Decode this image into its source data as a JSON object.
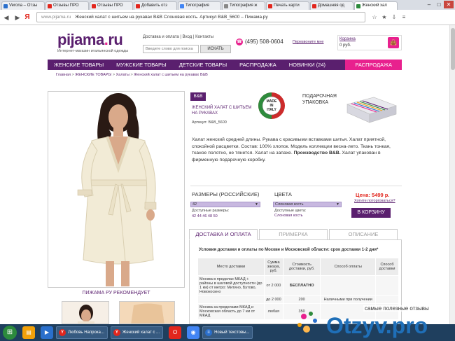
{
  "browser": {
    "tabs": [
      {
        "label": "Verona – Отзы",
        "color": "#2a6fcc",
        "active": false
      },
      {
        "label": "Отзывы ПРО",
        "color": "#e2261d",
        "active": false
      },
      {
        "label": "Отзывы ПРО",
        "color": "#e2261d",
        "active": false
      },
      {
        "label": "Добавить отз",
        "color": "#e2261d",
        "active": false
      },
      {
        "label": "Типография",
        "color": "#4285f4",
        "active": false
      },
      {
        "label": "Типография ж",
        "color": "#888888",
        "active": false
      },
      {
        "label": "Печать карти",
        "color": "#e2261d",
        "active": false
      },
      {
        "label": "Домашняя од",
        "color": "#e2261d",
        "active": false
      },
      {
        "label": "Женский хал",
        "color": "#2c8a3d",
        "active": true
      }
    ],
    "window_controls": {
      "minimize": "–",
      "maximize": "□",
      "close": "✕"
    },
    "yandex_letter": "Я",
    "url_host": "www.pijama.ru",
    "url_title": "Женский халат с шитьем на рукавах B&B Слоновая кость. Артикул B&B_5600 – Пижама.ру"
  },
  "site": {
    "logo_main": "pijama",
    "logo_dot": ".",
    "logo_tld": "ru",
    "tagline": "Интернет-магазин итальянской одежды",
    "top_links": [
      "Доставка и оплата",
      "Вход",
      "Контакты"
    ],
    "top_links_sep": " | ",
    "search_placeholder": "Введите слово для поиска",
    "search_button": "ИСКАТЬ",
    "phone": "(495) 508-0604",
    "callback": "Перезвоните мне",
    "cart_label": "Корзина",
    "cart_sum": "0 руб."
  },
  "nav": {
    "items": [
      "ЖЕНСКИЕ ТОВАРЫ",
      "МУЖСКИЕ ТОВАРЫ",
      "ДЕТСКИЕ ТОВАРЫ",
      "РАСПРОДАЖА",
      "НОВИНКИ (24)"
    ],
    "sale": "РАСПРОДАЖА"
  },
  "breadcrumb": {
    "items": [
      "Главная",
      "ЖЕНСКИЕ ТОВАРЫ",
      "Халаты",
      "Женский халат с шитьем на рукавах B&B"
    ],
    "sep": " > "
  },
  "product": {
    "brand": "B&B",
    "name": "ЖЕНСКИЙ ХАЛАТ С ШИТЬЕМ НА РУКАВАХ",
    "sku": "Артикул: B&B_5600",
    "seal_lines": [
      "MADE",
      "IN",
      "ITALY"
    ],
    "gift_label": "ПОДАРОЧНАЯ УПАКОВКА",
    "desc_part1": "Халат женский средней длины. Рукава с красивыми вставками шитья. Халат приятной, спокойной расцветки. Состав: 100% хлопок. Модель коллекции весна-лето. Ткань тонкая, тканое полотно, не тянется. Халат на запахе. ",
    "desc_bold": "Производство B&B.",
    "desc_part2": " Халат упакован в фирменную подарочную коробку.",
    "recommend": "ПИЖАМА РУ РЕКОМЕНДУЕТ",
    "size_label": "РАЗМЕРЫ (РОССИЙСКИЕ)",
    "size_value": "42",
    "size_avail_label": "Доступные размеры:",
    "size_avail_values": "42 44 46 48 50",
    "color_label": "ЦВЕТА",
    "color_value": "Слоновая кость",
    "color_avail_label": "Доступные цвета:",
    "color_avail_values": "Слоновая кость",
    "price": "Цена: 5499 р.",
    "haggle": "Хотите поторговаться?",
    "buy": "В КОРЗИНУ",
    "dropdown_arrow": "▼"
  },
  "tabs": {
    "delivery": "ДОСТАВКА И ОПЛАТА",
    "fitting": "ПРИМЕРКА",
    "description": "ОПИСАНИЕ"
  },
  "shipping": {
    "title": "Условия доставки и оплаты по Москве и Московской области: срок доставки 1-2 дня*",
    "headers": [
      "Место доставки",
      "Сумма заказа, руб.",
      "Стоимость доставки, руб.",
      "Способ оплаты",
      "Способ доставки"
    ],
    "rows": [
      [
        "Москва в пределах МКАД + районы в шаговой доступности (до 1 км) от метро: Митино, Бутово, Новокосино",
        "от 2 000",
        "БЕСПЛАТНО",
        "",
        ""
      ],
      [
        "",
        "до 2 000",
        "200",
        "Наличными при получении",
        ""
      ],
      [
        "Москва за пределами МКАД и Московская область до 7 км от МКАД",
        "любая",
        "350",
        "",
        ""
      ]
    ]
  },
  "taskbar": {
    "start": "⊞",
    "tasks": [
      "Любовь Напрока...",
      "Женский халат с ...",
      "Новый текстовы..."
    ]
  },
  "watermark": {
    "text": "самые полезные отзывы",
    "logo": "Otzyv.pro"
  }
}
